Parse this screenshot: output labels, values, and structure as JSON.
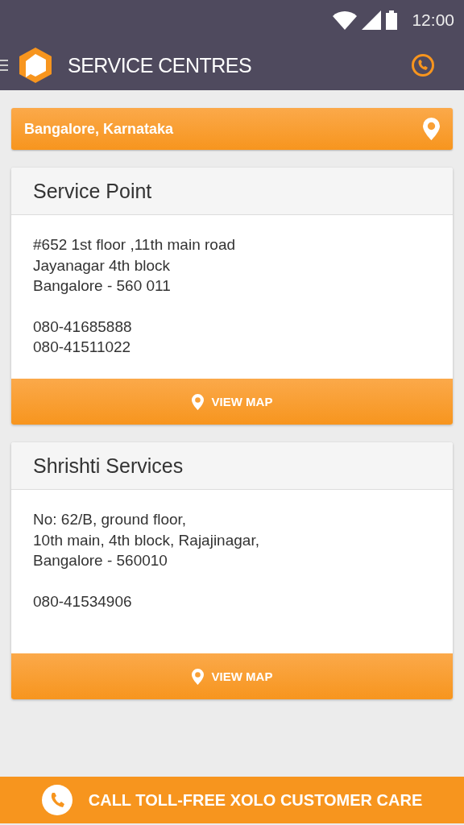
{
  "status_bar": {
    "time": "12:00"
  },
  "app_bar": {
    "title": "SERVICE CENTRES"
  },
  "location": {
    "text": "Bangalore, Karnataka"
  },
  "centres": [
    {
      "name": "Service Point",
      "address": [
        "#652 1st floor ,11th main road",
        "Jayanagar 4th block",
        "Bangalore - 560 011"
      ],
      "phones": [
        "080-41685888",
        "080-41511022"
      ],
      "button": "VIEW MAP"
    },
    {
      "name": "Shrishti Services",
      "address": [
        "No: 62/B, ground floor,",
        "10th main, 4th block, Rajajinagar,",
        "Bangalore - 560010"
      ],
      "phones": [
        "080-41534906"
      ],
      "button": "VIEW MAP"
    }
  ],
  "footer": {
    "label": "CALL TOLL-FREE XOLO CUSTOMER CARE"
  }
}
